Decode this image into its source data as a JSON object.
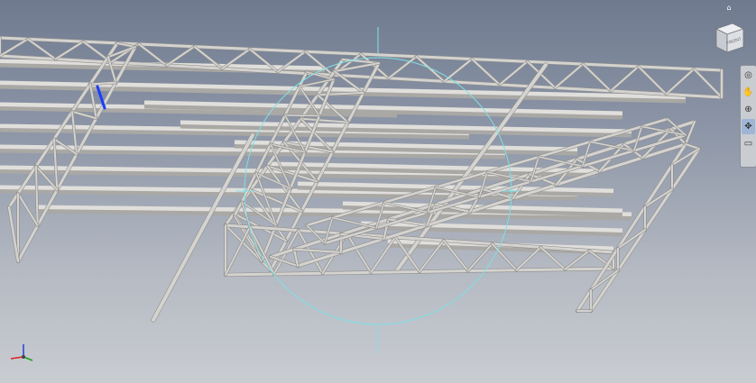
{
  "viewcube": {
    "face_label": "FRONT",
    "top_caption": ""
  },
  "navbar": {
    "items": [
      {
        "name": "steering-wheel",
        "glyph": "◎",
        "active": false
      },
      {
        "name": "pan",
        "glyph": "✋",
        "active": false
      },
      {
        "name": "zoom",
        "glyph": "⊕",
        "active": false
      },
      {
        "name": "orbit",
        "glyph": "✥",
        "active": true
      },
      {
        "name": "look-at",
        "glyph": "▭",
        "active": false
      }
    ]
  },
  "colors": {
    "truss": "#d4d3d0",
    "truss_shadow": "#8f8e8b",
    "beam_top": "#e0dfdc",
    "beam_side": "#a9a8a5",
    "orbit_circle": "#7fe0e6",
    "selection": "#1a3cff",
    "triad_x": "#e02020",
    "triad_y": "#20a020",
    "triad_z": "#2040e0"
  },
  "triad": {
    "x_label": "",
    "y_label": "",
    "z_label": ""
  }
}
